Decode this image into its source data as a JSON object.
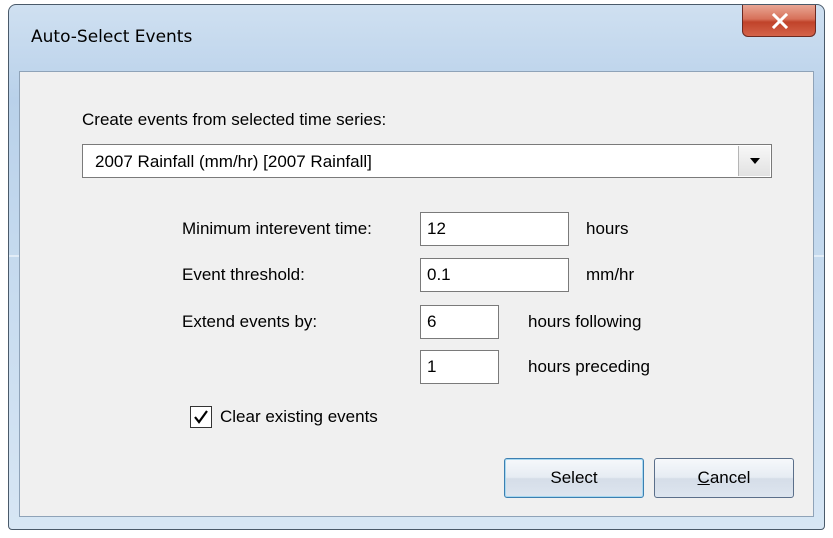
{
  "window": {
    "title": "Auto-Select Events",
    "close_icon": "close-icon"
  },
  "timeseries": {
    "label": "Create events from selected time series:",
    "selected": "2007 Rainfall (mm/hr) [2007 Rainfall]"
  },
  "fields": {
    "min_interevent": {
      "label": "Minimum interevent time:",
      "value": "12",
      "unit": "hours"
    },
    "threshold": {
      "label": "Event threshold:",
      "value": "0.1",
      "unit": "mm/hr"
    },
    "extend_following": {
      "label": "Extend events by:",
      "value": "6",
      "unit": "hours following"
    },
    "extend_preceding": {
      "value": "1",
      "unit": "hours preceding"
    }
  },
  "clear_existing": {
    "label": "Clear existing events",
    "checked": true
  },
  "buttons": {
    "select": "Select",
    "cancel_prefix": "C",
    "cancel_rest": "ancel"
  }
}
